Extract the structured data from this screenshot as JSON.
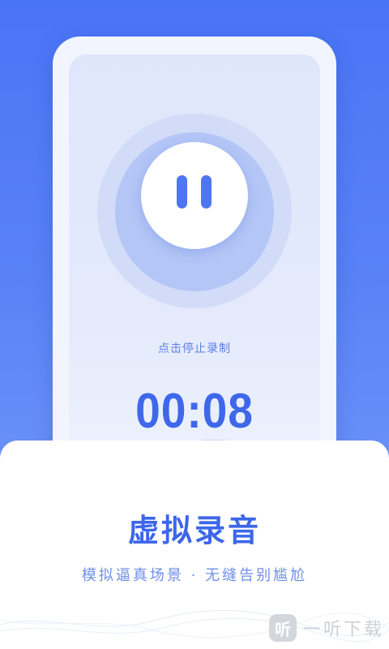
{
  "recorder": {
    "hint": "点击停止录制",
    "timer": "00:08"
  },
  "feature": {
    "title": "虚拟录音",
    "subtitle": "模拟逼真场景 · 无缝告别尴尬"
  },
  "watermark": {
    "logo_char": "听",
    "text": "一听下载"
  },
  "colors": {
    "background": "#4a74f6",
    "accent": "#3f67ea",
    "ring": "#b4c6f6",
    "card": "#ffffff"
  },
  "icons": [
    "pause-icon",
    "sound-wave-decoration",
    "watermark-logo-icon"
  ]
}
